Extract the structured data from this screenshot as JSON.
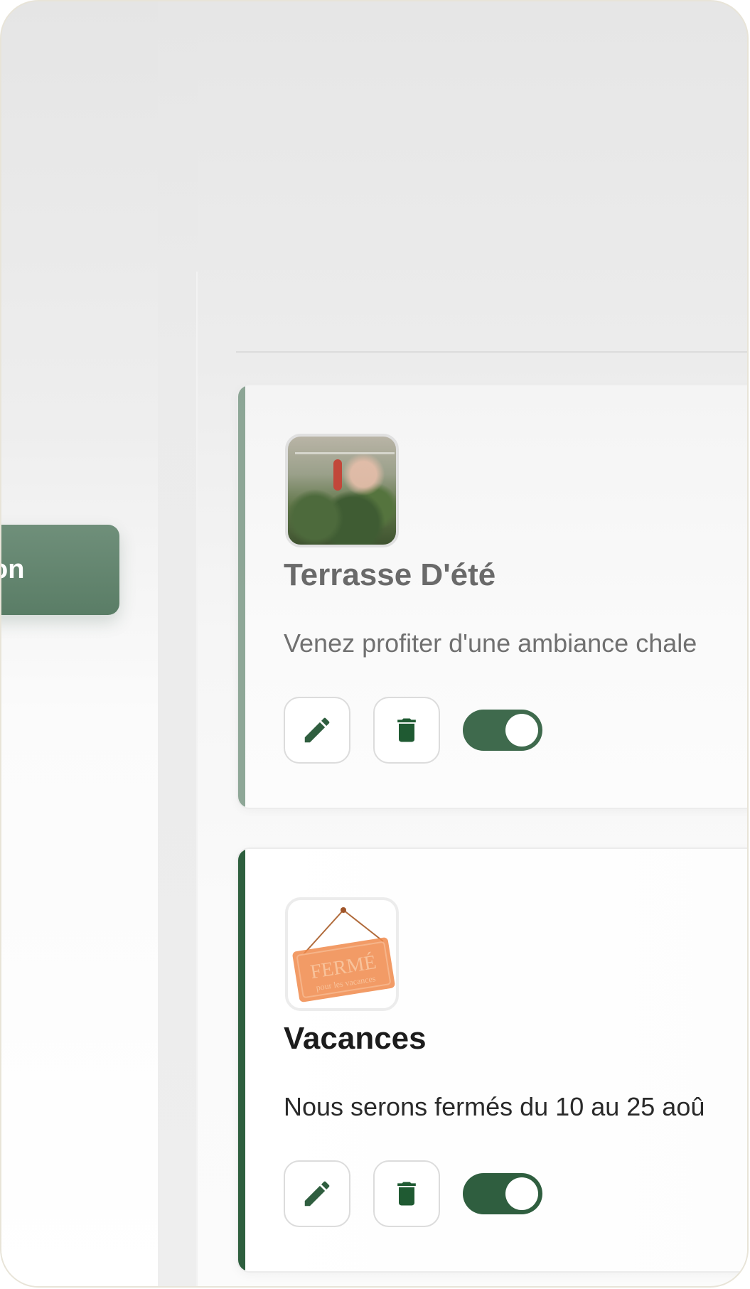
{
  "sidebar": {
    "button_label": "on"
  },
  "cards": [
    {
      "title": "Terrasse D'été",
      "description": "Venez profiter d'une ambiance chale",
      "image": "terrace-photo",
      "active": true
    },
    {
      "title": "Vacances",
      "description": "Nous serons fermés du 10 au 25 aoû",
      "image": "closed-sign",
      "image_text": [
        "FERMÉ",
        "pour les vacances"
      ],
      "active": true
    }
  ],
  "icons": {
    "edit": "pencil-icon",
    "delete": "trash-icon"
  },
  "colors": {
    "accent": "#2f5e3f",
    "accent_muted": "#6a8b75",
    "sign_orange": "#f08a4b"
  }
}
